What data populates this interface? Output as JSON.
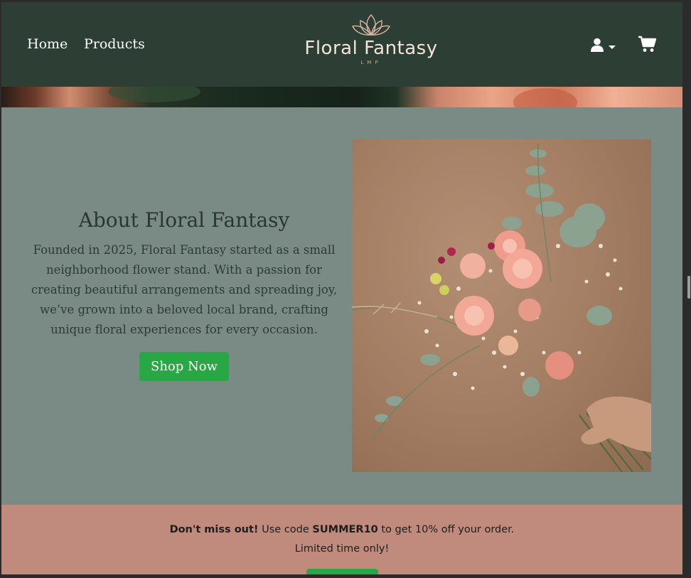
{
  "nav": {
    "home_label": "Home",
    "products_label": "Products"
  },
  "logo": {
    "title": "Floral Fantasy",
    "subtitle": "LMP"
  },
  "about": {
    "title": "About Floral Fantasy",
    "body": "Founded in 2025, Floral Fantasy started as a small neighborhood flower stand. With a passion for creating beautiful arrangements and spreading joy, we’ve grown into a beloved local brand, crafting unique floral experiences for every occasion.",
    "button_label": "Shop Now"
  },
  "promo": {
    "strong": "Don't miss out!",
    "text_before_code": " Use code ",
    "code": "SUMMER10",
    "text_after_code": " to get 10% off your order.",
    "line2": "Limited time only!"
  },
  "icons": {
    "user": "user-icon",
    "cart": "cart-icon",
    "lotus": "lotus-icon"
  },
  "colors": {
    "navbar": "#2d3e35",
    "section_bg": "#7a8b86",
    "promo_bg": "#c08a7c",
    "button_green": "#27a844"
  }
}
